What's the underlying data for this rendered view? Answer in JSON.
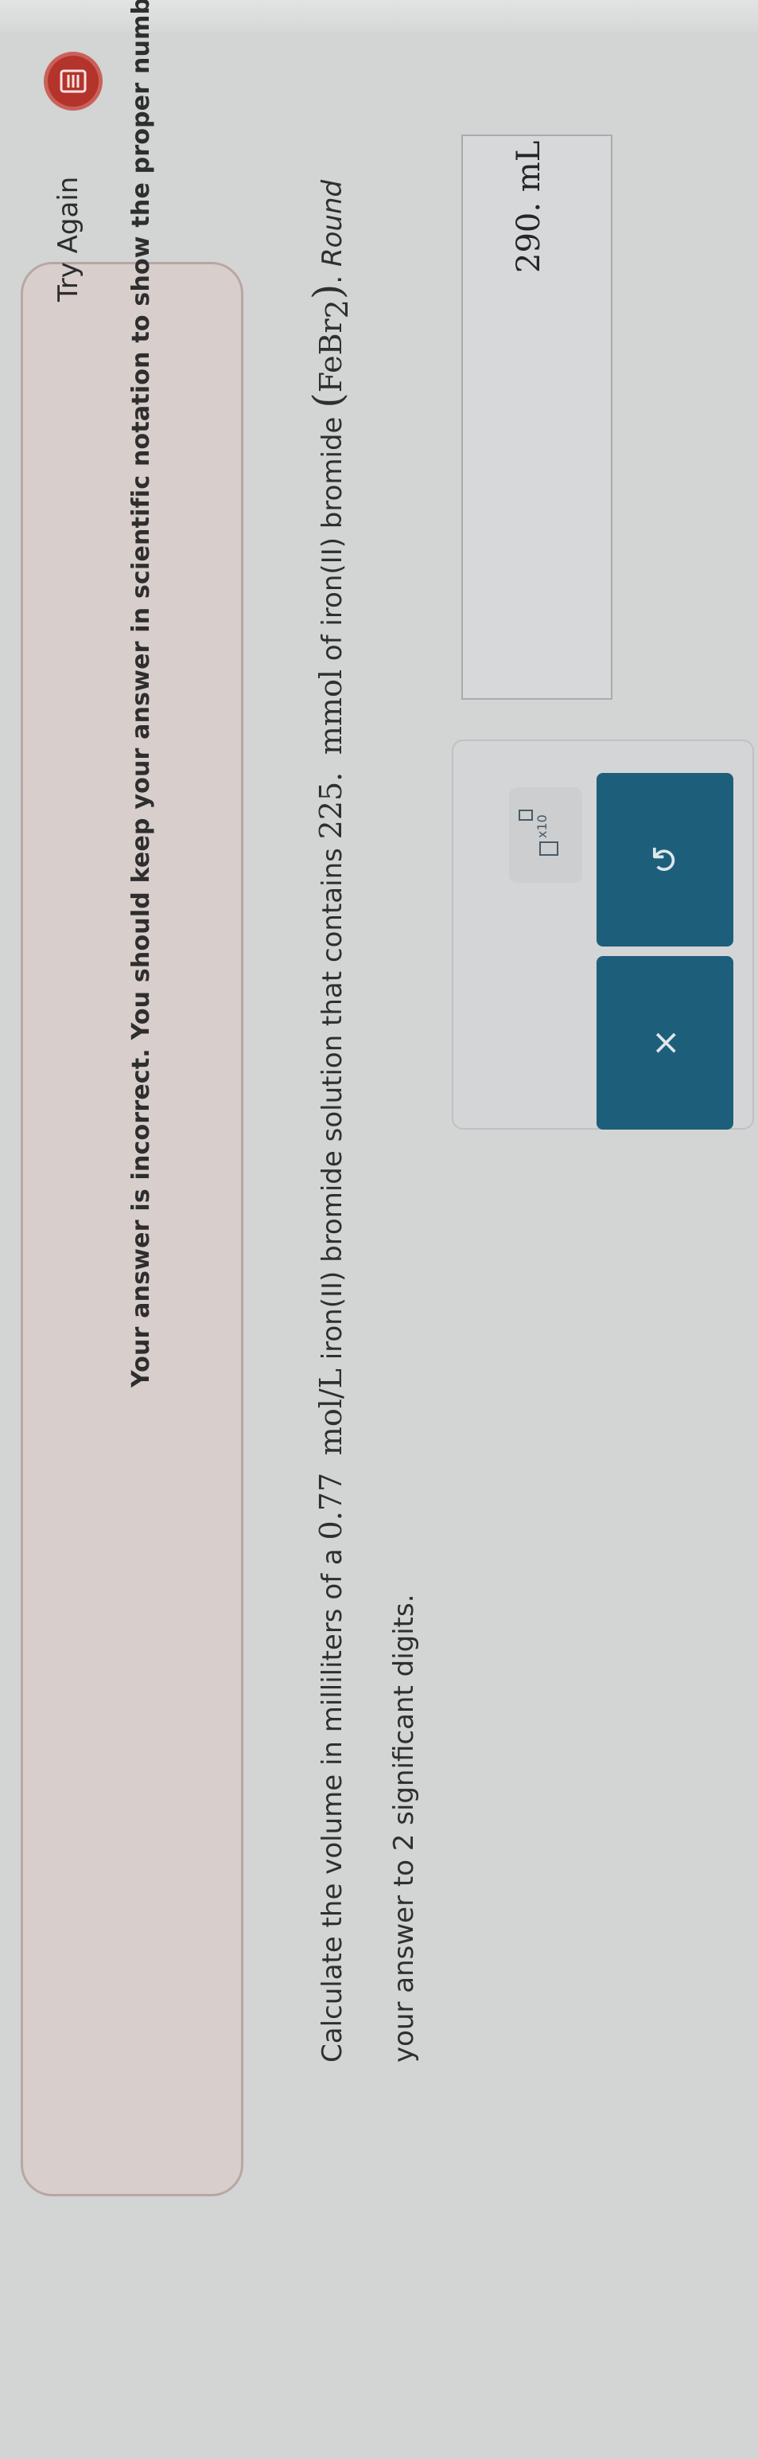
{
  "feedback": {
    "title": "Try Again",
    "icon": "feedback-list-icon",
    "icon_color": "#b4332b",
    "message": "Your answer is incorrect. You should keep your answer in scientific notation to show the proper number of significant digits."
  },
  "question": {
    "part1": "Calculate the volume in milliliters of a ",
    "concentration": "0.77",
    "concentration_unit": "mol/L",
    "part2": " iron(II) bromide solution that contains ",
    "amount": "225.",
    "amount_unit": "mmol",
    "part3": " of iron(II) bromide ",
    "formula": "FeBr",
    "formula_sub": "2",
    "part4": ". ",
    "round_text": "Round",
    "part5": " your answer to 2 significant digits."
  },
  "answer": {
    "value": "290. mL"
  },
  "tools": {
    "sci_notation_label": "x10",
    "undo_symbol": "↺",
    "clear_symbol": "×",
    "button_color": "#1d5f7a"
  }
}
